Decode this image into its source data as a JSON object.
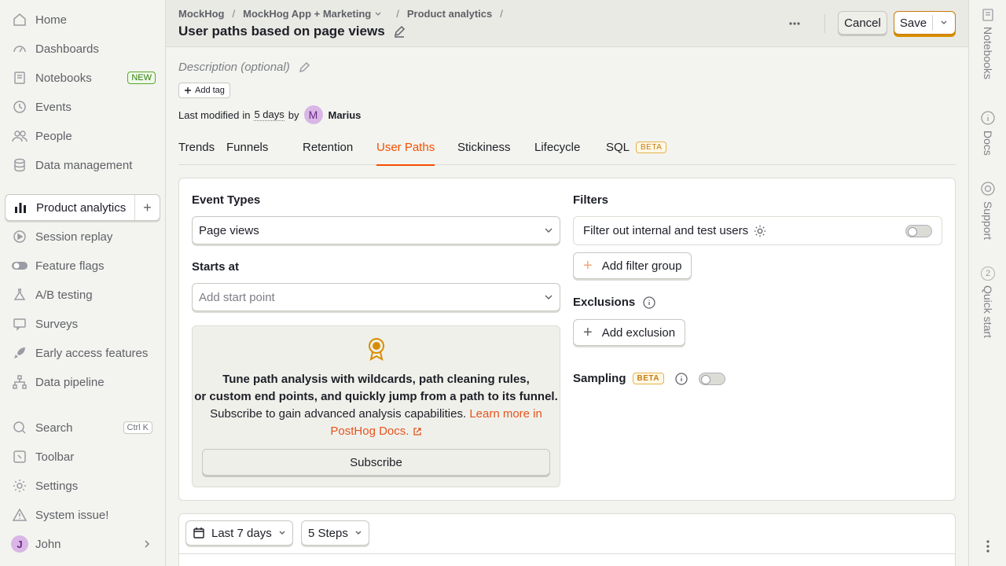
{
  "sidebar": {
    "items": [
      {
        "label": "Home",
        "icon": "home-icon"
      },
      {
        "label": "Dashboards",
        "icon": "dashboard-icon"
      },
      {
        "label": "Notebooks",
        "icon": "notebook-icon",
        "badge": "NEW"
      },
      {
        "label": "Events",
        "icon": "events-icon"
      },
      {
        "label": "People",
        "icon": "people-icon"
      },
      {
        "label": "Data management",
        "icon": "database-icon"
      },
      {
        "label": "Product analytics",
        "icon": "bar-chart-icon"
      },
      {
        "label": "Session replay",
        "icon": "replay-icon"
      },
      {
        "label": "Feature flags",
        "icon": "toggle-icon"
      },
      {
        "label": "A/B testing",
        "icon": "flask-icon"
      },
      {
        "label": "Surveys",
        "icon": "survey-icon"
      },
      {
        "label": "Early access features",
        "icon": "rocket-icon"
      },
      {
        "label": "Data pipeline",
        "icon": "pipeline-icon"
      },
      {
        "label": "Search",
        "icon": "search-icon",
        "shortcut": "Ctrl K"
      },
      {
        "label": "Toolbar",
        "icon": "toolbar-icon"
      },
      {
        "label": "Settings",
        "icon": "gear-icon"
      },
      {
        "label": "System issue!",
        "icon": "warning-icon"
      },
      {
        "label": "John",
        "avatar": "J"
      }
    ]
  },
  "header": {
    "breadcrumbs": [
      "MockHog",
      "MockHog App + Marketing",
      "Product analytics"
    ],
    "title": "User paths based on page views",
    "cancel_label": "Cancel",
    "save_label": "Save"
  },
  "right_rail": {
    "items": [
      {
        "label": "Notebooks"
      },
      {
        "label": "Docs"
      },
      {
        "label": "Support"
      },
      {
        "label": "Quick start",
        "count": "2"
      }
    ]
  },
  "meta": {
    "description_placeholder": "Description (optional)",
    "add_tag_label": "Add tag",
    "last_modified_prefix": "Last modified",
    "last_modified_in": "in",
    "last_modified_when": "5 days",
    "last_modified_by": "by",
    "author_initial": "M",
    "author_name": "Marius"
  },
  "tabs": [
    {
      "label": "Trends"
    },
    {
      "label": "Funnels"
    },
    {
      "label": "Retention"
    },
    {
      "label": "User Paths",
      "active": true
    },
    {
      "label": "Stickiness"
    },
    {
      "label": "Lifecycle"
    },
    {
      "label": "SQL",
      "badge": "BETA"
    }
  ],
  "query": {
    "event_types_label": "Event Types",
    "event_types_value": "Page views",
    "starts_at_label": "Starts at",
    "starts_at_placeholder": "Add start point",
    "upsell": {
      "line1": "Tune path analysis with wildcards, path cleaning rules,",
      "line2": "or custom end points, and quickly jump from a path to its funnel.",
      "line3_text": "Subscribe to gain advanced analysis capabilities.",
      "link_part1": "Learn more in",
      "link_part2": "PostHog Docs.",
      "button": "Subscribe"
    },
    "filters_label": "Filters",
    "filter_internal_label": "Filter out internal and test users",
    "add_filter_group_label": "Add filter group",
    "exclusions_label": "Exclusions",
    "add_exclusion_label": "Add exclusion",
    "sampling_label": "Sampling",
    "sampling_badge": "BETA"
  },
  "results": {
    "date_range": "Last 7 days",
    "steps": "5 Steps"
  },
  "colors": {
    "accent": "#f54e00",
    "save_border": "#d88e00",
    "new_badge": "#58a72c"
  }
}
